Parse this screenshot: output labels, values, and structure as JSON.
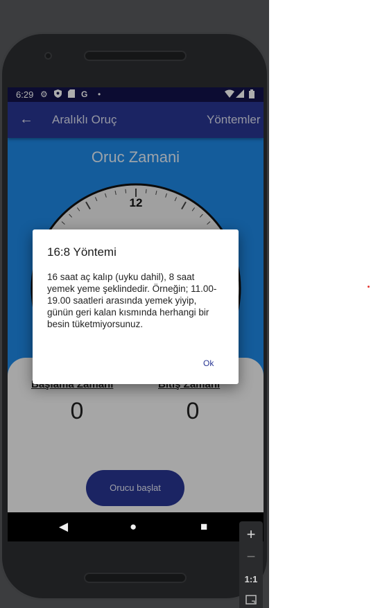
{
  "status_bar": {
    "time": "6:29",
    "left_icons": [
      "gear-icon",
      "shield-icon",
      "sd-card-icon",
      "google-icon",
      "dot-icon"
    ],
    "right_icons": [
      "wifi-icon",
      "signal-icon",
      "battery-icon"
    ]
  },
  "app_bar": {
    "title": "Aralıklı Oruç",
    "action": "Yöntemler"
  },
  "main": {
    "section_title": "Oruc Zamani",
    "clock_top_number": "12",
    "start_label": "Başlama Zamanı",
    "start_value": "0",
    "end_label": "Bitiş Zamanı",
    "end_value": "0",
    "start_button": "Orucu başlat"
  },
  "dialog": {
    "title": "16:8 Yöntemi",
    "body": "16 saat aç kalıp (uyku dahil), 8 saat yemek yeme şeklindedir. Örneğin; 11.00-19.00 saatleri arasında yemek yiyip, günün geri kalan kısmında herhangi bir besin tüketmiyorsunuz.",
    "ok_label": "Ok"
  },
  "nav_bar": {
    "back": "◀",
    "home": "●",
    "recents": "■"
  },
  "emulator_controls": {
    "zoom_in": "+",
    "zoom_out": "−",
    "actual_size": "1:1"
  },
  "colors": {
    "primary": "#283593",
    "content_bg": "#1e88e5",
    "status_bar": "#13134b"
  }
}
